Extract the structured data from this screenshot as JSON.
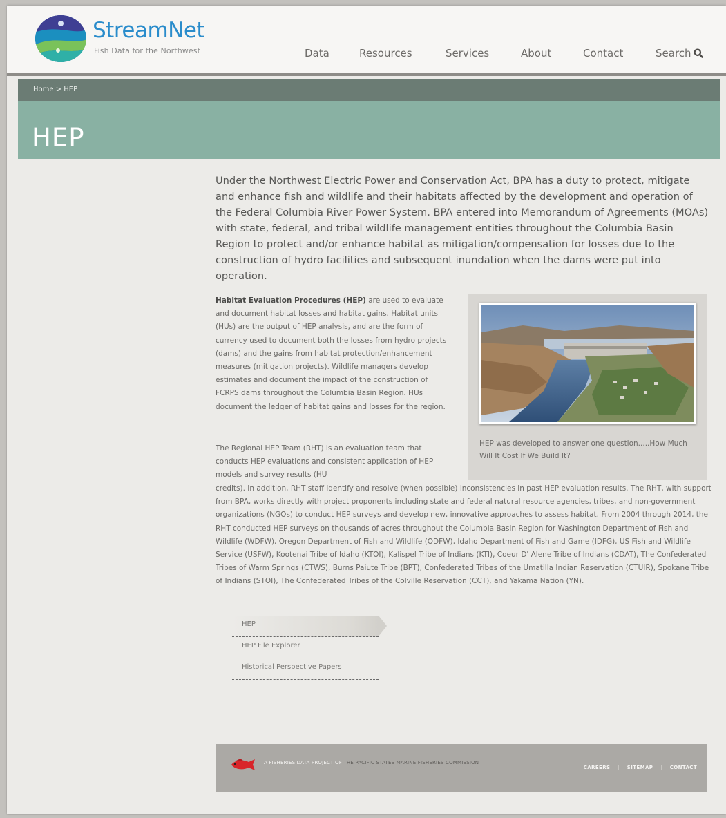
{
  "header": {
    "brand_name": "StreamNet",
    "brand_tagline": "Fish Data for the Northwest",
    "nav": [
      {
        "label": "Data"
      },
      {
        "label": "Resources"
      },
      {
        "label": "Services"
      },
      {
        "label": "About"
      },
      {
        "label": "Contact"
      },
      {
        "label": "Search"
      }
    ]
  },
  "breadcrumb": "Home > HEP",
  "page_title": "HEP",
  "lead_paragraph": "Under the Northwest Electric Power and Conservation Act, BPA has a duty to protect, mitigate and enhance fish and wildlife and their habitats affected by the development and operation of the Federal Columbia River Power System. BPA entered into Memorandum of Agreements (MOAs) with state, federal, and tribal wildlife management entities throughout the Columbia Basin Region to protect and/or enhance habitat as mitigation/compensation for losses due to the construction of hydro facilities and subsequent inundation when the dams were put into operation.",
  "paragraph1": {
    "bold_lead": "Habitat Evaluation Procedures (HEP)",
    "text": " are used to evaluate and document habitat losses and habitat gains. Habitat units (HUs) are the output of HEP analysis, and are the form of currency used to document both the losses from hydro projects (dams) and the gains from habitat protection/enhancement measures (mitigation projects). Wildlife managers develop estimates and document the impact of the construction of FCRPS dams throughout the Columbia Basin Region. HUs document the ledger of habitat gains and losses for the region."
  },
  "paragraph2_start": "The Regional HEP Team (RHT) is an evaluation team that conducts HEP evaluations and consistent application of HEP models and survey results (HU",
  "paragraph2_rest": "credits). In addition, RHT staff identify and resolve (when possible) inconsistencies in past HEP evaluation results. The RHT, with support from BPA, works directly with project proponents including state and federal natural resource agencies, tribes, and non-government organizations (NGOs) to conduct HEP surveys and develop new, innovative approaches to assess habitat. From 2004 through 2014, the RHT conducted HEP surveys on thousands of acres throughout the Columbia Basin Region for Washington Department of Fish and Wildlife (WDFW), Oregon Department of Fish and Wildlife (ODFW), Idaho Department of Fish and Game (IDFG), US Fish and Wildlife Service (USFW), Kootenai Tribe of Idaho (KTOI), Kalispel Tribe of Indians (KTI), Coeur D' Alene Tribe of Indians (CDAT), The Confederated Tribes of Warm Springs (CTWS), Burns Paiute Tribe (BPT), Confederated Tribes of the Umatilla Indian Reservation (CTUIR), Spokane Tribe of Indians (STOI), The Confederated Tribes of the Colville Reservation (CCT), and Yakama Nation (YN).",
  "figure": {
    "caption": "HEP was developed to answer one question.....How Much Will It Cost If We Build It?"
  },
  "subnav": [
    {
      "label": "HEP",
      "active": true
    },
    {
      "label": "HEP File Explorer"
    },
    {
      "label": "Historical Perspective Papers"
    }
  ],
  "footer": {
    "prefix": "A FISHERIES DATA PROJECT OF ",
    "org": "THE PACIFIC STATES MARINE FISHERIES COMMISSION",
    "links": [
      "CAREERS",
      "SITEMAP",
      "CONTACT"
    ],
    "separator": "|"
  },
  "colors": {
    "brand_blue": "#2a8ccb",
    "breadcrumb_bg": "#6b7c74",
    "title_band": "#89b1a3",
    "footer_bg": "#aba9a5",
    "fish_red": "#d8252a"
  }
}
